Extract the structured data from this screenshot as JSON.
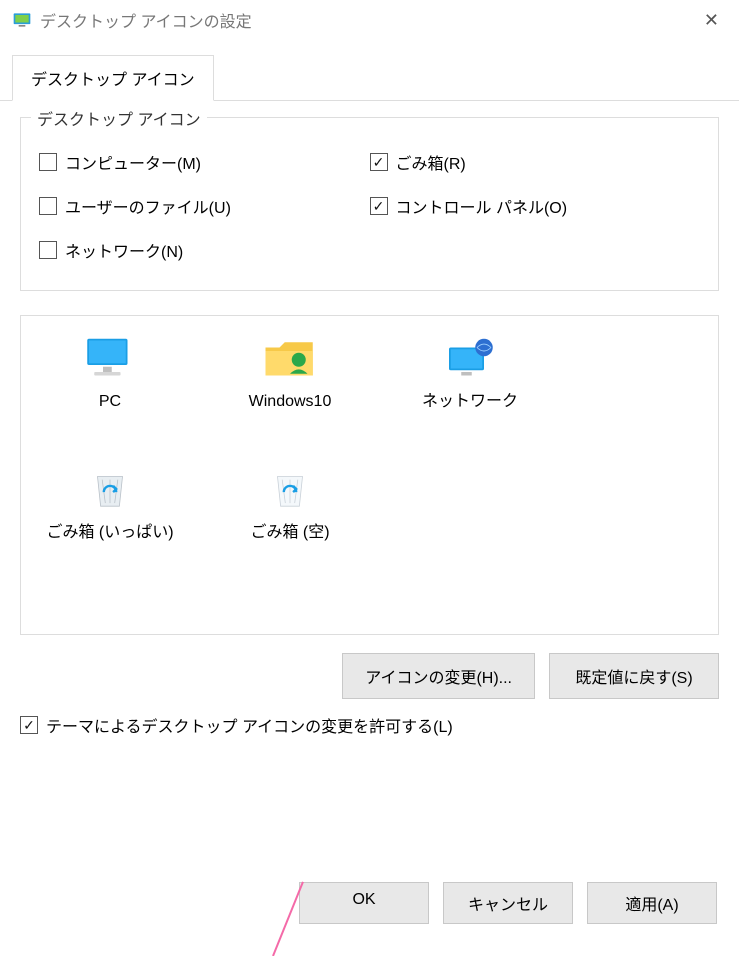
{
  "titlebar": {
    "title": "デスクトップ アイコンの設定"
  },
  "tab": {
    "label": "デスクトップ アイコン"
  },
  "group": {
    "title": "デスクトップ アイコン",
    "items": [
      {
        "label": "コンピューター(M)",
        "checked": false
      },
      {
        "label": "ごみ箱(R)",
        "checked": true
      },
      {
        "label": "ユーザーのファイル(U)",
        "checked": false
      },
      {
        "label": "コントロール パネル(O)",
        "checked": true
      },
      {
        "label": "ネットワーク(N)",
        "checked": false
      }
    ]
  },
  "icons": [
    {
      "label": "PC",
      "kind": "monitor"
    },
    {
      "label": "Windows10",
      "kind": "userfolder"
    },
    {
      "label": "ネットワーク",
      "kind": "network"
    },
    {
      "label": "ごみ箱 (いっぱい)",
      "kind": "bin-full"
    },
    {
      "label": "ごみ箱 (空)",
      "kind": "bin-empty"
    }
  ],
  "buttons": {
    "changeIcon": "アイコンの変更(H)...",
    "restoreDefault": "既定値に戻す(S)"
  },
  "themeCheckbox": {
    "label": "テーマによるデスクトップ アイコンの変更を許可する(L)",
    "checked": true
  },
  "dialogButtons": {
    "ok": "OK",
    "cancel": "キャンセル",
    "apply": "適用(A)"
  }
}
